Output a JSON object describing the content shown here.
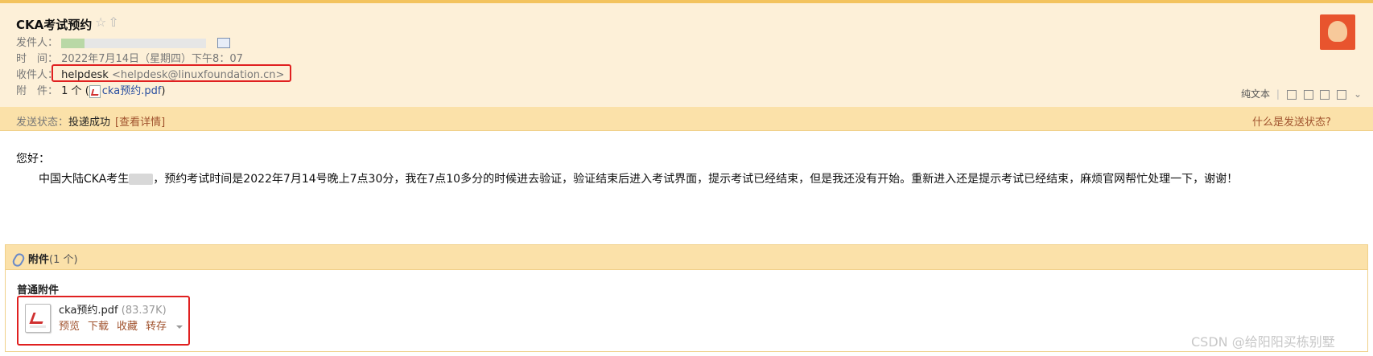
{
  "email": {
    "subject": "CKA考试预约",
    "sender_label": "发件人：",
    "time_label": "时　间：",
    "time_value": "2022年7月14日（星期四）下午8：07",
    "recipient_label": "收件人：",
    "recipient_name": "helpdesk",
    "recipient_email": "<helpdesk@linuxfoundation.cn>",
    "attachment_label": "附　件：",
    "attachment_count": "1 个",
    "attachment_filename": "cka预约.pdf"
  },
  "toolbar": {
    "plain_text": "纯文本"
  },
  "status": {
    "label": "发送状态：",
    "value": "投递成功",
    "details_link": "[查看详情]",
    "help_link": "什么是发送状态?"
  },
  "body": {
    "greeting": "您好：",
    "para1_part1": "中国大陆CKA考生",
    "para1_part2": "，预约考试时间是2022年7月14号晚上7点30分，我在7点10多分的时候进去验证，验证结束后进入考试界面，提示考试已经结束，但是我还没有开始。重新进入还是提示考试已经结束，麻烦官网帮忙处理一下，谢谢！"
  },
  "attachments": {
    "header_title": "附件",
    "header_count": "(1 个)",
    "section": "普通附件",
    "file": {
      "name": "cka预约.pdf",
      "size": "(83.37K)",
      "actions": [
        "预览",
        "下载",
        "收藏",
        "转存"
      ]
    }
  },
  "watermark": "CSDN @给阳阳买栋别墅",
  "colors": {
    "header_bg": "#fdf0d8",
    "status_bg": "#fbe1a9",
    "highlight": "#e02020",
    "link": "#a0522d"
  }
}
